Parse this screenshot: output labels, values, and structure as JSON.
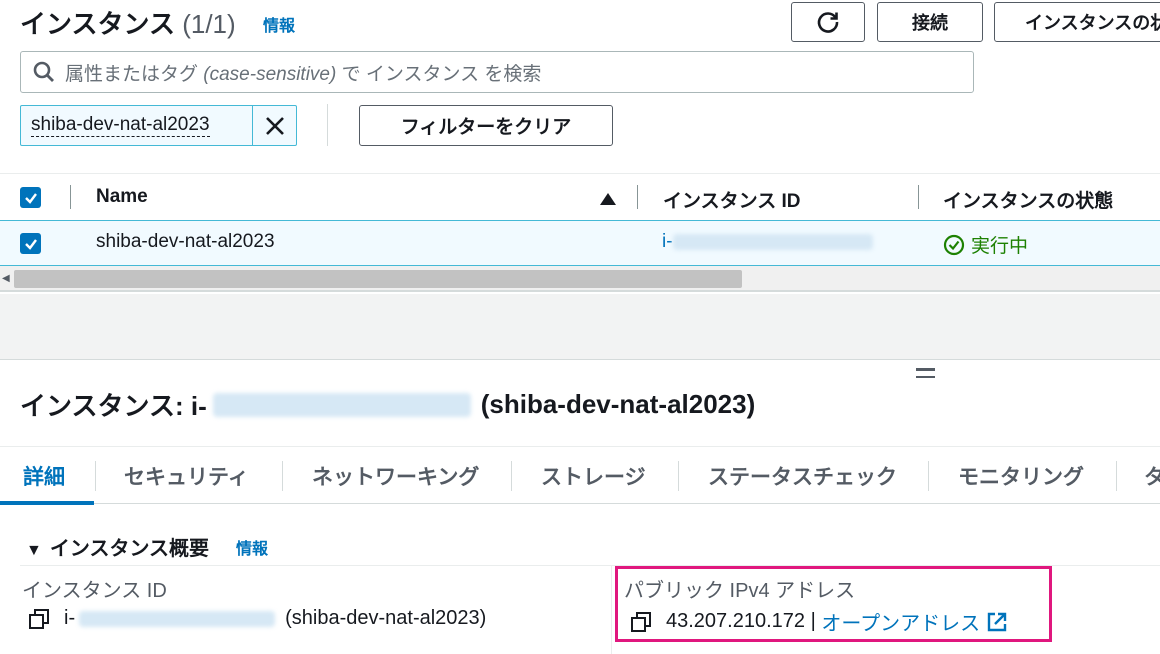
{
  "header": {
    "title": "インスタンス",
    "count": "(1/1)",
    "info": "情報",
    "connect_label": "接続",
    "state_label": "インスタンスの状態"
  },
  "search": {
    "placeholder_prefix": "属性またはタグ ",
    "placeholder_em": "(case-sensitive)",
    "placeholder_suffix": " で インスタンス を検索"
  },
  "filter": {
    "token": "shiba-dev-nat-al2023",
    "clear_label": "フィルターをクリア"
  },
  "table": {
    "columns": [
      "Name",
      "インスタンス ID",
      "インスタンスの状態"
    ],
    "rows": [
      {
        "name": "shiba-dev-nat-al2023",
        "id_prefix": "i-",
        "state": "実行中"
      }
    ]
  },
  "detail": {
    "title_prefix": "インスタンス: i-",
    "title_suffix": "(shiba-dev-nat-al2023)",
    "tabs": [
      "詳細",
      "セキュリティ",
      "ネットワーキング",
      "ストレージ",
      "ステータスチェック",
      "モニタリング",
      "タ"
    ],
    "section_title": "インスタンス概要",
    "section_info": "情報",
    "instance_id_label": "インスタンス ID",
    "instance_id_prefix": "i-",
    "instance_id_suffix": "(shiba-dev-nat-al2023)",
    "public_ip_label": "パブリック IPv4 アドレス",
    "public_ip": "43.207.210.172",
    "public_ip_sep": " | ",
    "open_address": "オープンアドレス"
  },
  "colors": {
    "accent": "#0073bb",
    "success": "#1d8102",
    "highlight": "#e0177e"
  }
}
